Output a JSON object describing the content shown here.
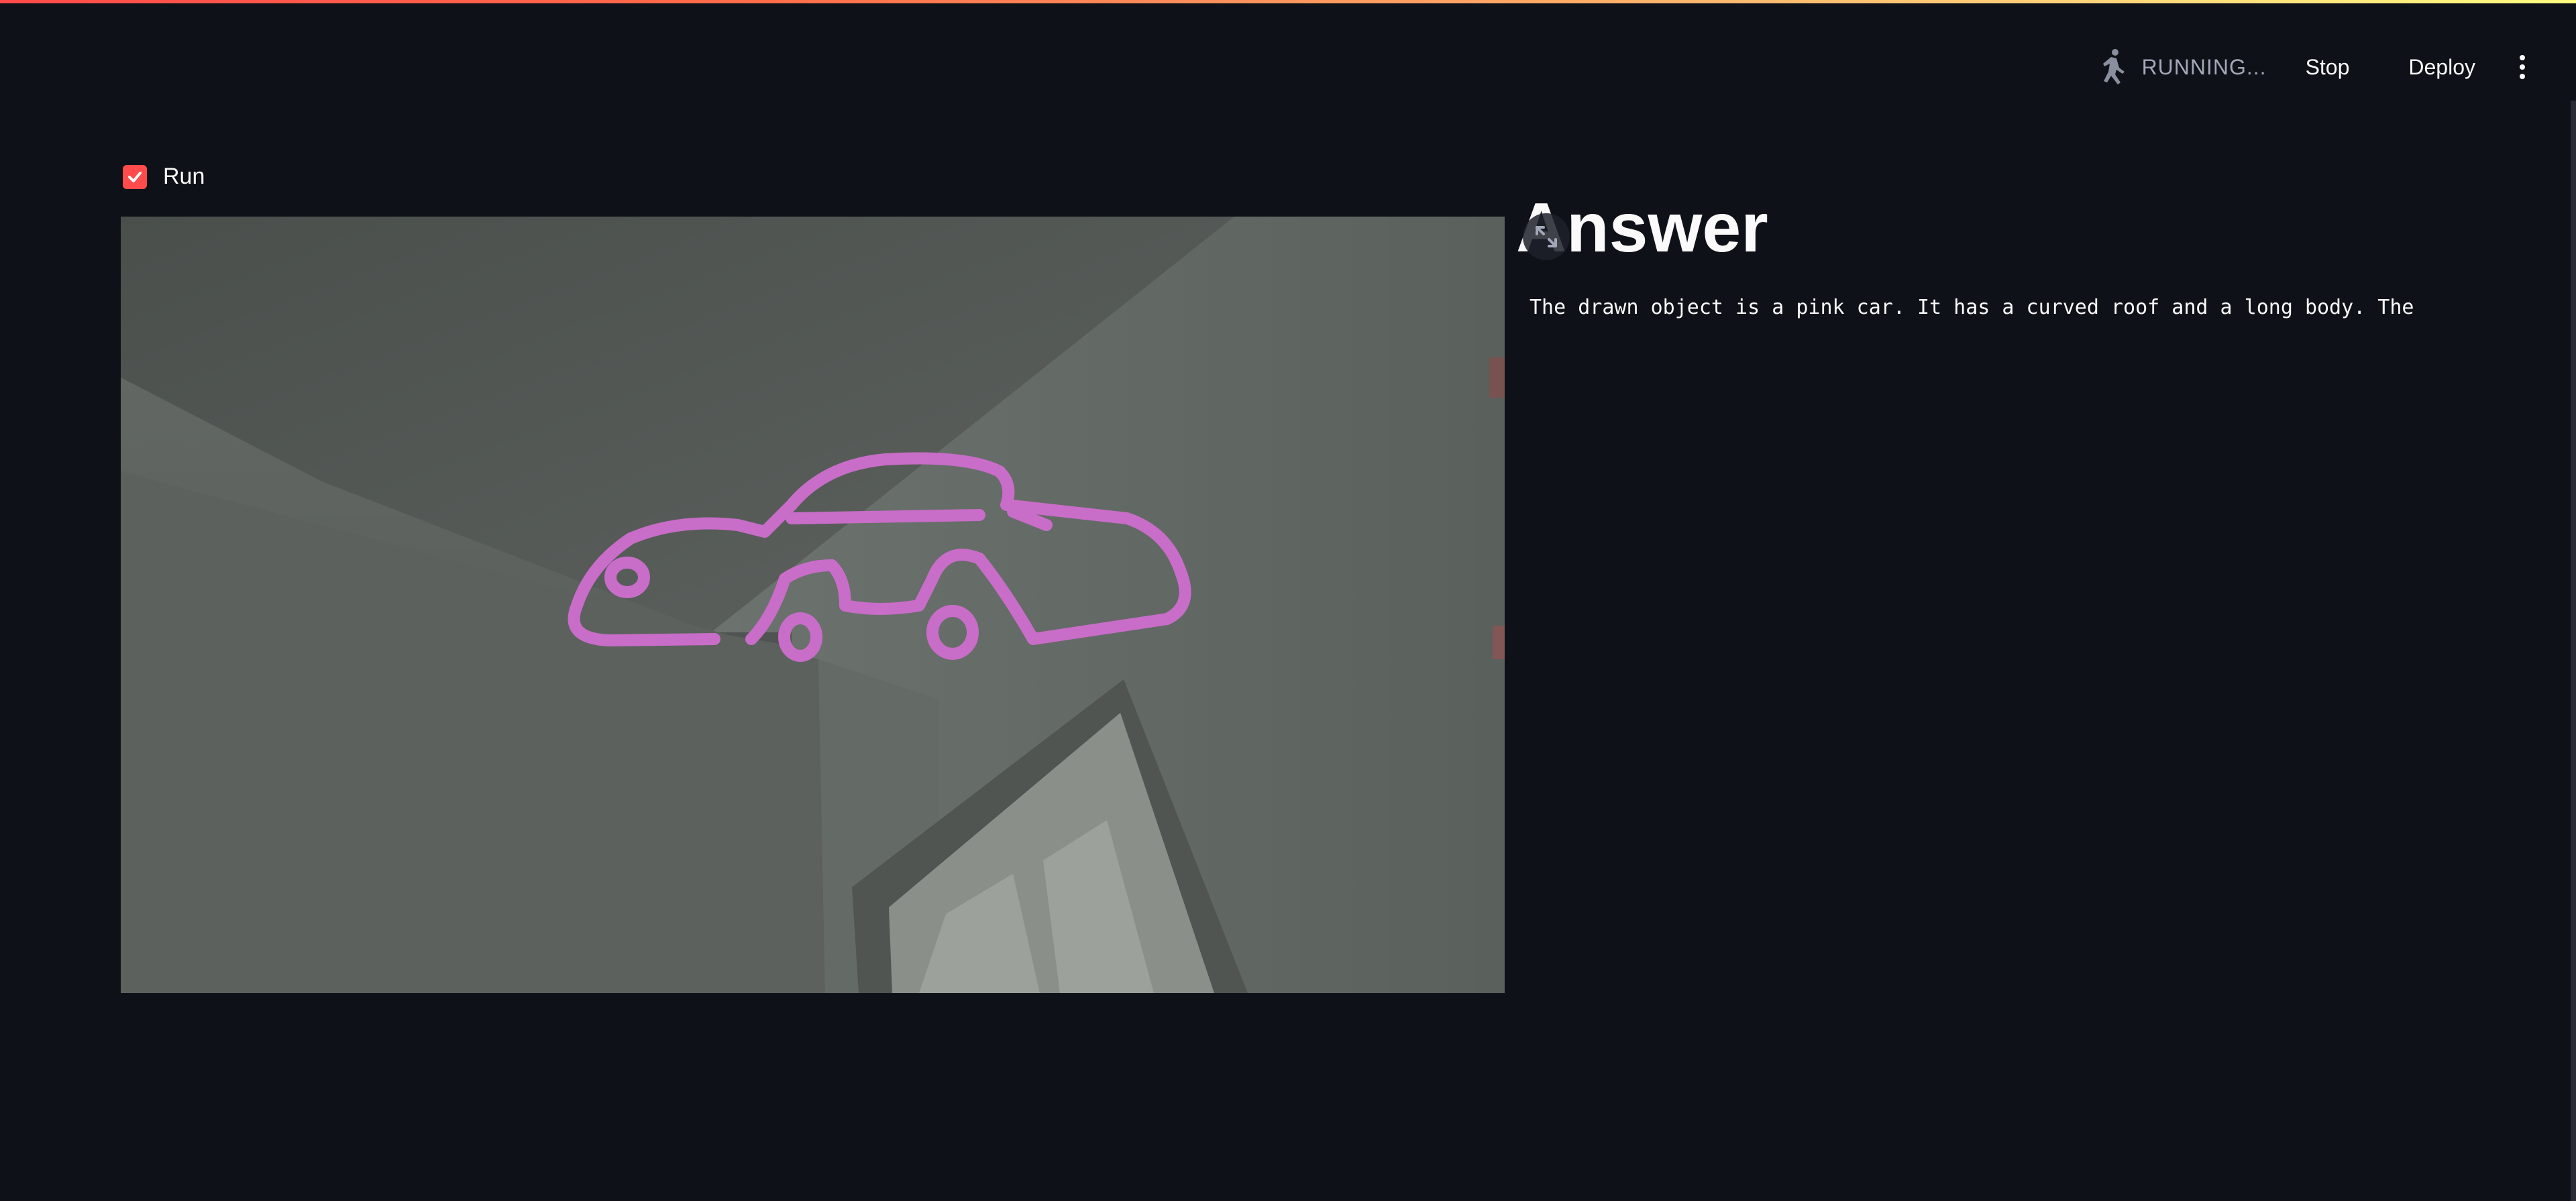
{
  "header": {
    "status_label": "RUNNING...",
    "stop_label": "Stop",
    "deploy_label": "Deploy",
    "status_icon": "running-person-icon",
    "menu_icon": "kebab-menu-icon",
    "accent_gradient": [
      "#ff4b4b",
      "#fffd80"
    ]
  },
  "controls": {
    "run_checkbox_label": "Run",
    "run_checked": true,
    "checkbox_color": "#ff4b4b"
  },
  "video": {
    "description_icon": "webcam-frame",
    "drawing_color": "#c86dc8"
  },
  "answer": {
    "title": "Answer",
    "text": "The drawn object is a pink car. It has a curved roof and a long body. The",
    "fullscreen_icon": "fullscreen-icon"
  },
  "colors": {
    "background": "#0e1117",
    "text": "#fafafa",
    "muted": "#a3a8b8"
  }
}
